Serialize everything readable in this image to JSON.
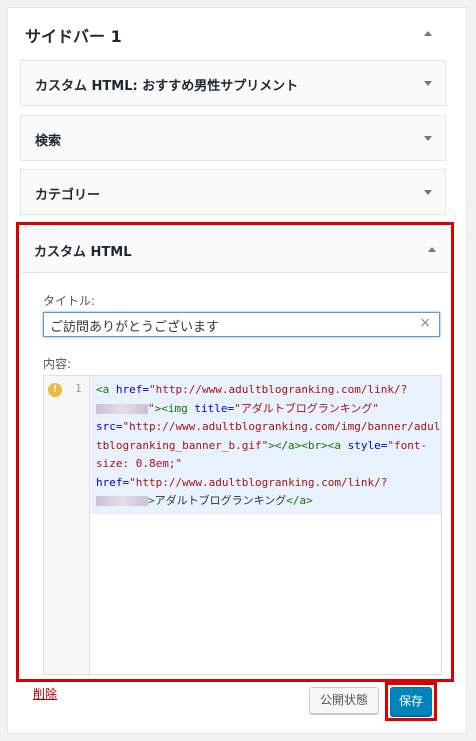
{
  "sidebar": {
    "title": "サイドバー 1",
    "widgets": [
      {
        "title_main": "カスタム",
        "title_rest": " HTML: おすすめ男性サプリメント"
      },
      {
        "title_main": "検索",
        "title_rest": ""
      },
      {
        "title_main": "カテゴリー",
        "title_rest": ""
      }
    ]
  },
  "custom_html_widget": {
    "title_main": "カスタム",
    "title_rest": " HTML",
    "title_label": "タイトル:",
    "title_value": "ご訪問ありがとうございます",
    "content_label": "内容:",
    "line_number": "1",
    "code": {
      "l1_tag": "<a ",
      "l1_attr": "href=",
      "l1_val": "\"http://www.adultblogranking.com/link/?",
      "l2_val": "\"",
      "l2_tag": "><img ",
      "l2_attr": "title=",
      "l2_val2": "\"アダルトブログランキング\"",
      "l3_attr": "src=",
      "l3_val": "\"http://www.adultblogranking.com/img/banner/adul",
      "l4_val": "tblogranking_banner_b.gif\"",
      "l4_tag": "></a><br><a ",
      "l4_attr": "style=",
      "l4_val2": "\"font-",
      "l5_val": "size: 0.8em;\"",
      "l6_attr": "href=",
      "l6_val": "\"http://www.adultblogranking.com/link/?",
      "l7_tag": ">",
      "l7_text": "アダルトブログランキング",
      "l7_close": "</a>"
    },
    "delete_label": "削除",
    "public_label": "公開状態",
    "save_label": "保存"
  }
}
